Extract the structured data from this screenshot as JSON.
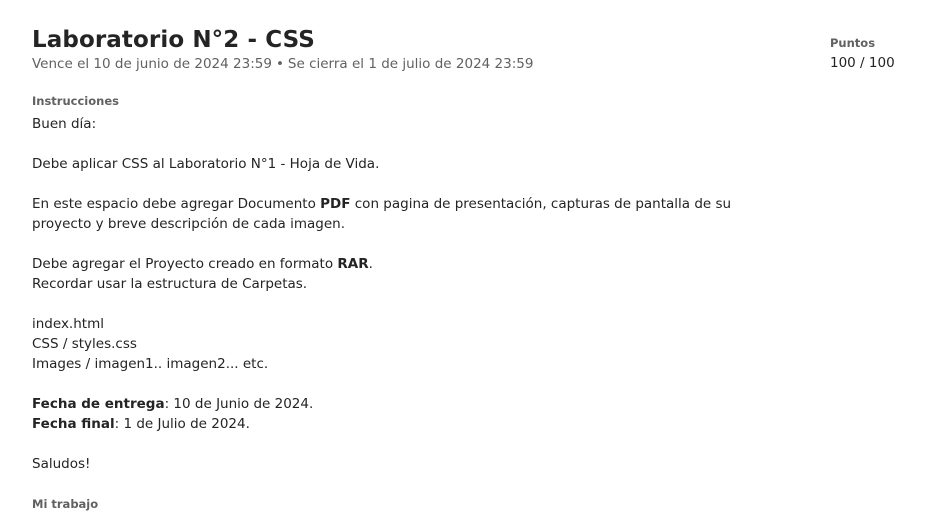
{
  "assignment": {
    "title": "Laboratorio N°2 - CSS",
    "due": "Vence el 10 de junio de 2024 23:59",
    "separator": "•",
    "closes": "Se cierra el 1 de julio de 2024 23:59",
    "points_label": "Puntos",
    "points_value": "100 / 100"
  },
  "instructions": {
    "label": "Instrucciones",
    "greeting": "Buen día:",
    "p1": "Debe aplicar CSS al Laboratorio N°1 - Hoja de Vida.",
    "p2_pre": "En este espacio debe agregar Documento ",
    "p2_bold": "PDF",
    "p2_post": " con pagina de presentación, capturas de pantalla de su proyecto y breve descripción de cada imagen.",
    "p3_pre": "Debe agregar el Proyecto creado en formato ",
    "p3_bold": "RAR",
    "p3_post": ".",
    "p3_line2": "Recordar usar la estructura de Carpetas.",
    "files": [
      "index.html",
      "CSS / styles.css",
      "Images / imagen1.. imagen2... etc."
    ],
    "entrega_label": "Fecha de entrega",
    "entrega_value": ": 10 de Junio de 2024.",
    "final_label": "Fecha final",
    "final_value": ": 1 de Julio de 2024.",
    "closing": "Saludos!"
  },
  "my_work": {
    "label": "Mi trabajo"
  }
}
